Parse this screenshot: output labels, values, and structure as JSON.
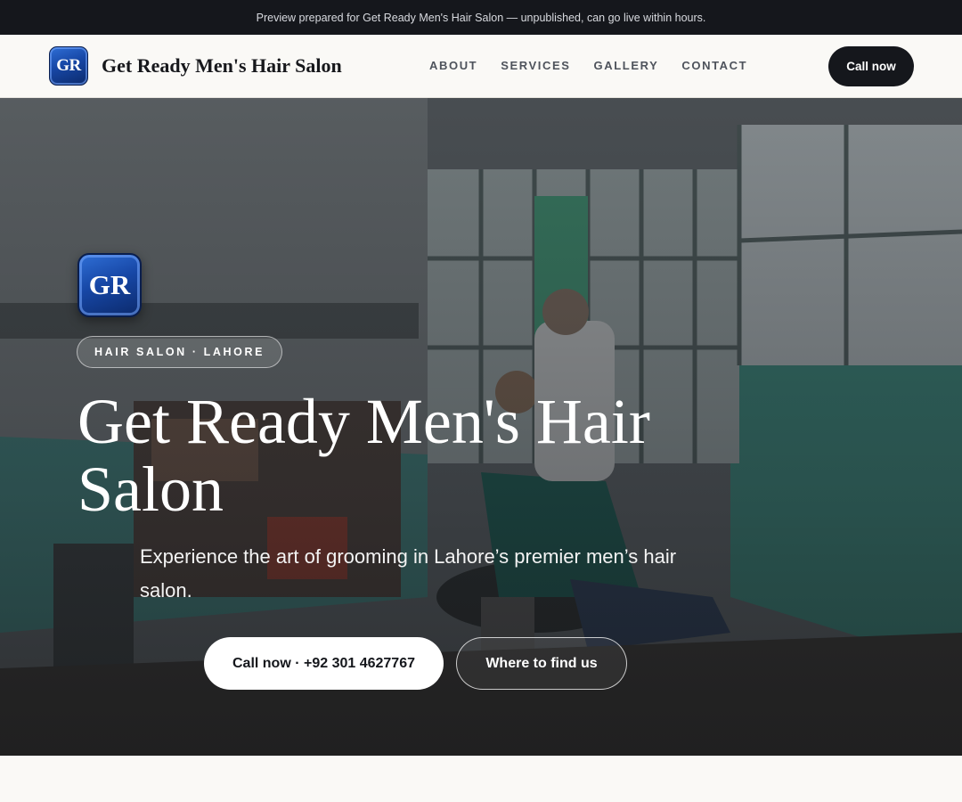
{
  "preview_banner": "Preview prepared for Get Ready Men's Hair Salon — unpublished, can go live within hours.",
  "header": {
    "logo_initials": "GR",
    "brand_name": "Get Ready Men's Hair Salon",
    "nav": [
      "ABOUT",
      "SERVICES",
      "GALLERY",
      "CONTACT"
    ],
    "cta_label": "Call now"
  },
  "hero": {
    "logo_initials": "GR",
    "eyebrow": "HAIR SALON · LAHORE",
    "title": "Get Ready Men's Hair Salon",
    "subtitle": "Experience the art of grooming in Lahore’s premier men’s hair salon.",
    "primary_button": "Call now · +92 301 4627767",
    "secondary_button": "Where to find us"
  },
  "colors": {
    "dark": "#15171c",
    "page_bg": "#faf9f6",
    "logo_blue": "#1747a6"
  }
}
